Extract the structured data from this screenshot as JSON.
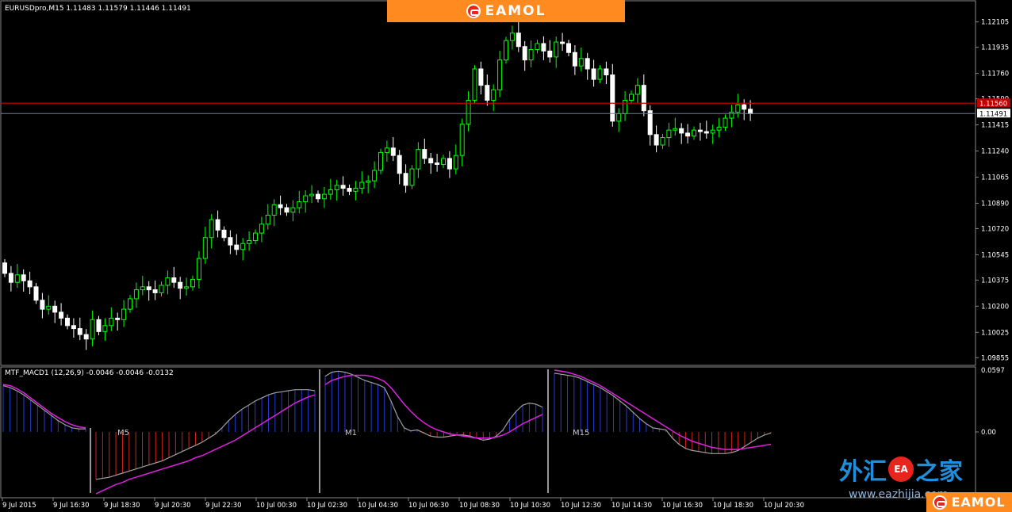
{
  "header": {
    "symbol_line": "EURUSDpro,M15  1.11483 1.11579 1.11446 1.11491",
    "indicator_line": "MTF_MACD1 (12,26,9) -0.0046 -0.0046 -0.0132"
  },
  "banner": {
    "logo_text": "EAMOL"
  },
  "watermark": {
    "cn_left": "外汇",
    "cn_mark": "EA",
    "cn_right": "之家",
    "url": "www.eazhijia.com",
    "corner_text": "EAMOL"
  },
  "colors": {
    "bull_candle": "#00ff00",
    "bear_candle": "#ffffff",
    "bid_line": "#c00000",
    "current_line": "#6f7f8f",
    "macd_positive": "#2a3bd6",
    "macd_negative": "#d42020",
    "signal_line": "#e020e0",
    "macd_line": "#a0a0a0"
  },
  "chart_data": {
    "type": "candlestick",
    "symbol": "EURUSDpro",
    "timeframe": "M15",
    "price_axis_ticks": [
      "1.12105",
      "1.11935",
      "1.11760",
      "1.11590",
      "1.11415",
      "1.11240",
      "1.11065",
      "1.10890",
      "1.10720",
      "1.10545",
      "1.10375",
      "1.10200",
      "1.10025",
      "1.09855"
    ],
    "ylim": [
      1.0983,
      1.1222
    ],
    "price_tag_red": "1.11560",
    "price_tag_current": "1.11491",
    "current_price": 1.11491,
    "red_line_price": 1.1156,
    "x_ticks": [
      "9 Jul 2015",
      "9 Jul 16:30",
      "9 Jul 18:30",
      "9 Jul 20:30",
      "9 Jul 22:30",
      "10 Jul 00:30",
      "10 Jul 02:30",
      "10 Jul 04:30",
      "10 Jul 06:30",
      "10 Jul 08:30",
      "10 Jul 10:30",
      "10 Jul 12:30",
      "10 Jul 14:30",
      "10 Jul 16:30",
      "10 Jul 18:30",
      "10 Jul 20:30"
    ],
    "close": [
      1.1042,
      1.1036,
      1.1041,
      1.1037,
      1.1033,
      1.1024,
      1.1018,
      1.102,
      1.1016,
      1.1012,
      1.1007,
      1.1005,
      1.1001,
      1.0998,
      1.1011,
      1.1003,
      1.1007,
      1.1012,
      1.1011,
      1.1018,
      1.1025,
      1.1031,
      1.1033,
      1.1031,
      1.1029,
      1.1034,
      1.1039,
      1.1036,
      1.1032,
      1.1033,
      1.1038,
      1.1052,
      1.1066,
      1.1078,
      1.1071,
      1.1066,
      1.1061,
      1.1058,
      1.1062,
      1.1064,
      1.1069,
      1.1075,
      1.1081,
      1.1088,
      1.1086,
      1.1083,
      1.1086,
      1.109,
      1.1094,
      1.1095,
      1.1092,
      1.1095,
      1.1098,
      1.1101,
      1.1099,
      1.1097,
      1.1099,
      1.1103,
      1.1104,
      1.1111,
      1.1123,
      1.1126,
      1.1121,
      1.1109,
      1.1101,
      1.1112,
      1.1125,
      1.1119,
      1.1116,
      1.1115,
      1.1119,
      1.1112,
      1.1121,
      1.1142,
      1.1158,
      1.1179,
      1.1168,
      1.1158,
      1.1165,
      1.1185,
      1.1198,
      1.1203,
      1.1194,
      1.1185,
      1.1192,
      1.1196,
      1.1191,
      1.1187,
      1.1197,
      1.1196,
      1.119,
      1.1181,
      1.1186,
      1.1179,
      1.1172,
      1.1179,
      1.1175,
      1.1144,
      1.1149,
      1.1158,
      1.1162,
      1.1168,
      1.1151,
      1.1135,
      1.1128,
      1.1133,
      1.1138,
      1.1139,
      1.1136,
      1.1134,
      1.1138,
      1.1137,
      1.1136,
      1.1138,
      1.114,
      1.1146,
      1.115,
      1.1155,
      1.1152,
      1.1149
    ],
    "open": [
      1.1049,
      1.1042,
      1.1036,
      1.1041,
      1.1037,
      1.1033,
      1.1024,
      1.1018,
      1.102,
      1.1016,
      1.1012,
      1.1007,
      1.1005,
      1.1001,
      1.0998,
      1.1011,
      1.1003,
      1.1007,
      1.1012,
      1.1011,
      1.1018,
      1.1025,
      1.1031,
      1.1033,
      1.1031,
      1.1029,
      1.1034,
      1.1039,
      1.1036,
      1.1032,
      1.1033,
      1.1038,
      1.1052,
      1.1066,
      1.1078,
      1.1071,
      1.1066,
      1.1061,
      1.1058,
      1.1062,
      1.1064,
      1.1069,
      1.1075,
      1.1081,
      1.1088,
      1.1086,
      1.1083,
      1.1086,
      1.109,
      1.1094,
      1.1095,
      1.1092,
      1.1095,
      1.1098,
      1.1101,
      1.1099,
      1.1097,
      1.1099,
      1.1103,
      1.1104,
      1.1111,
      1.1123,
      1.1126,
      1.1121,
      1.1109,
      1.1101,
      1.1112,
      1.1125,
      1.1119,
      1.1116,
      1.1115,
      1.1119,
      1.1112,
      1.1121,
      1.1142,
      1.1158,
      1.1179,
      1.1168,
      1.1158,
      1.1165,
      1.1185,
      1.1198,
      1.1203,
      1.1194,
      1.1185,
      1.1192,
      1.1196,
      1.1191,
      1.1187,
      1.1197,
      1.1196,
      1.119,
      1.1181,
      1.1186,
      1.1179,
      1.1172,
      1.1179,
      1.1175,
      1.1144,
      1.1149,
      1.1158,
      1.1162,
      1.1168,
      1.1151,
      1.1135,
      1.1128,
      1.1133,
      1.1138,
      1.1139,
      1.1136,
      1.1134,
      1.1138,
      1.1137,
      1.1136,
      1.1138,
      1.114,
      1.1146,
      1.115,
      1.1155,
      1.1152
    ],
    "macd_panel": {
      "label_top": "0.0597",
      "label_zero": "0.00",
      "sub_labels": [
        "M5",
        "M1",
        "M15"
      ],
      "segments": [
        {
          "hist": [
            0.045,
            0.043,
            0.04,
            0.036,
            0.031,
            0.026,
            0.021,
            0.016,
            0.011,
            0.007,
            0.004,
            0.003,
            0.003
          ],
          "signal": [
            0.046,
            0.045,
            0.042,
            0.038,
            0.033,
            0.028,
            0.023,
            0.018,
            0.014,
            0.01,
            0.007,
            0.005,
            0.004
          ]
        },
        {
          "hist": [
            -0.046,
            -0.045,
            -0.044,
            -0.042,
            -0.04,
            -0.038,
            -0.036,
            -0.034,
            -0.032,
            -0.03,
            -0.028,
            -0.025,
            -0.022,
            -0.019,
            -0.016,
            -0.013,
            -0.01,
            -0.006,
            -0.002,
            0.004,
            0.011,
            0.017,
            0.022,
            0.026,
            0.03,
            0.033,
            0.036,
            0.038,
            0.039,
            0.04,
            0.041,
            0.041,
            0.041,
            0.04
          ],
          "signal": [
            -0.06,
            -0.057,
            -0.054,
            -0.051,
            -0.049,
            -0.046,
            -0.044,
            -0.042,
            -0.04,
            -0.038,
            -0.036,
            -0.034,
            -0.032,
            -0.03,
            -0.028,
            -0.025,
            -0.023,
            -0.02,
            -0.017,
            -0.014,
            -0.011,
            -0.008,
            -0.004,
            0.0,
            0.004,
            0.008,
            0.012,
            0.016,
            0.02,
            0.024,
            0.028,
            0.031,
            0.034,
            0.036
          ]
        },
        {
          "hist": [
            0.054,
            0.058,
            0.059,
            0.058,
            0.056,
            0.053,
            0.05,
            0.048,
            0.046,
            0.043,
            0.03,
            0.015,
            0.004,
            0.001,
            0.002,
            -0.001,
            -0.004,
            -0.005,
            -0.005,
            -0.004,
            -0.003,
            -0.003,
            -0.004,
            -0.006,
            -0.008,
            -0.007,
            -0.004,
            0.002,
            0.012,
            0.02,
            0.026,
            0.028,
            0.027,
            0.024
          ],
          "signal": [
            0.046,
            0.05,
            0.052,
            0.054,
            0.055,
            0.055,
            0.055,
            0.054,
            0.052,
            0.049,
            0.043,
            0.035,
            0.027,
            0.02,
            0.014,
            0.009,
            0.005,
            0.002,
            0.0,
            -0.002,
            -0.003,
            -0.004,
            -0.005,
            -0.006,
            -0.006,
            -0.006,
            -0.005,
            -0.003,
            0.0,
            0.004,
            0.008,
            0.011,
            0.014,
            0.017
          ]
        },
        {
          "hist": [
            0.057,
            0.056,
            0.055,
            0.054,
            0.052,
            0.049,
            0.046,
            0.043,
            0.039,
            0.035,
            0.03,
            0.025,
            0.019,
            0.013,
            0.008,
            0.004,
            0.003,
            0.002,
            -0.006,
            -0.012,
            -0.016,
            -0.018,
            -0.019,
            -0.02,
            -0.021,
            -0.021,
            -0.021,
            -0.02,
            -0.018,
            -0.014,
            -0.01,
            -0.006,
            -0.003,
            -0.001
          ],
          "signal": [
            0.06,
            0.059,
            0.058,
            0.056,
            0.054,
            0.051,
            0.048,
            0.045,
            0.041,
            0.037,
            0.033,
            0.029,
            0.025,
            0.021,
            0.017,
            0.013,
            0.009,
            0.005,
            0.001,
            -0.003,
            -0.006,
            -0.009,
            -0.011,
            -0.013,
            -0.015,
            -0.016,
            -0.017,
            -0.017,
            -0.017,
            -0.016,
            -0.015,
            -0.014,
            -0.013,
            -0.012
          ]
        }
      ]
    }
  }
}
